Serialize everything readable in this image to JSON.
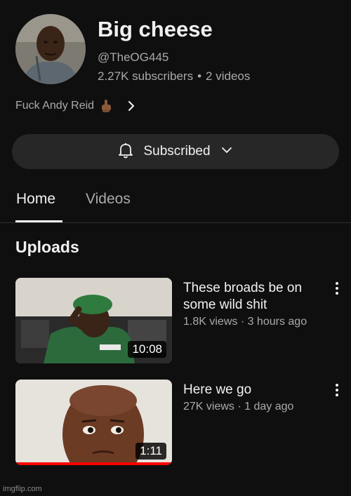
{
  "channel": {
    "name": "Big cheese",
    "handle": "@TheOG445",
    "subscribers": "2.27K subscribers",
    "separator": "•",
    "videos": "2 videos",
    "description": "Fuck Andy Reid",
    "description_emoji": "middle-finger-emoji"
  },
  "subscribe_button": {
    "label": "Subscribed",
    "icon": "bell-icon",
    "menu_icon": "chevron-down-icon"
  },
  "tabs": [
    {
      "label": "Home",
      "active": true
    },
    {
      "label": "Videos",
      "active": false
    }
  ],
  "section": {
    "title": "Uploads"
  },
  "videos": [
    {
      "title": "These broads be on some wild shit",
      "meta": "1.8K views · 3 hours ago",
      "duration": "10:08",
      "watch_progress": 0
    },
    {
      "title": "Here we go",
      "meta": "27K views · 1 day ago",
      "duration": "1:11",
      "watch_progress": 1.0
    }
  ],
  "watermark": "imgflip.com",
  "colors": {
    "background": "#0f0f0f",
    "button_bg": "#272727",
    "secondary_text": "#aaaaaa",
    "progress_red": "#ff0000"
  }
}
